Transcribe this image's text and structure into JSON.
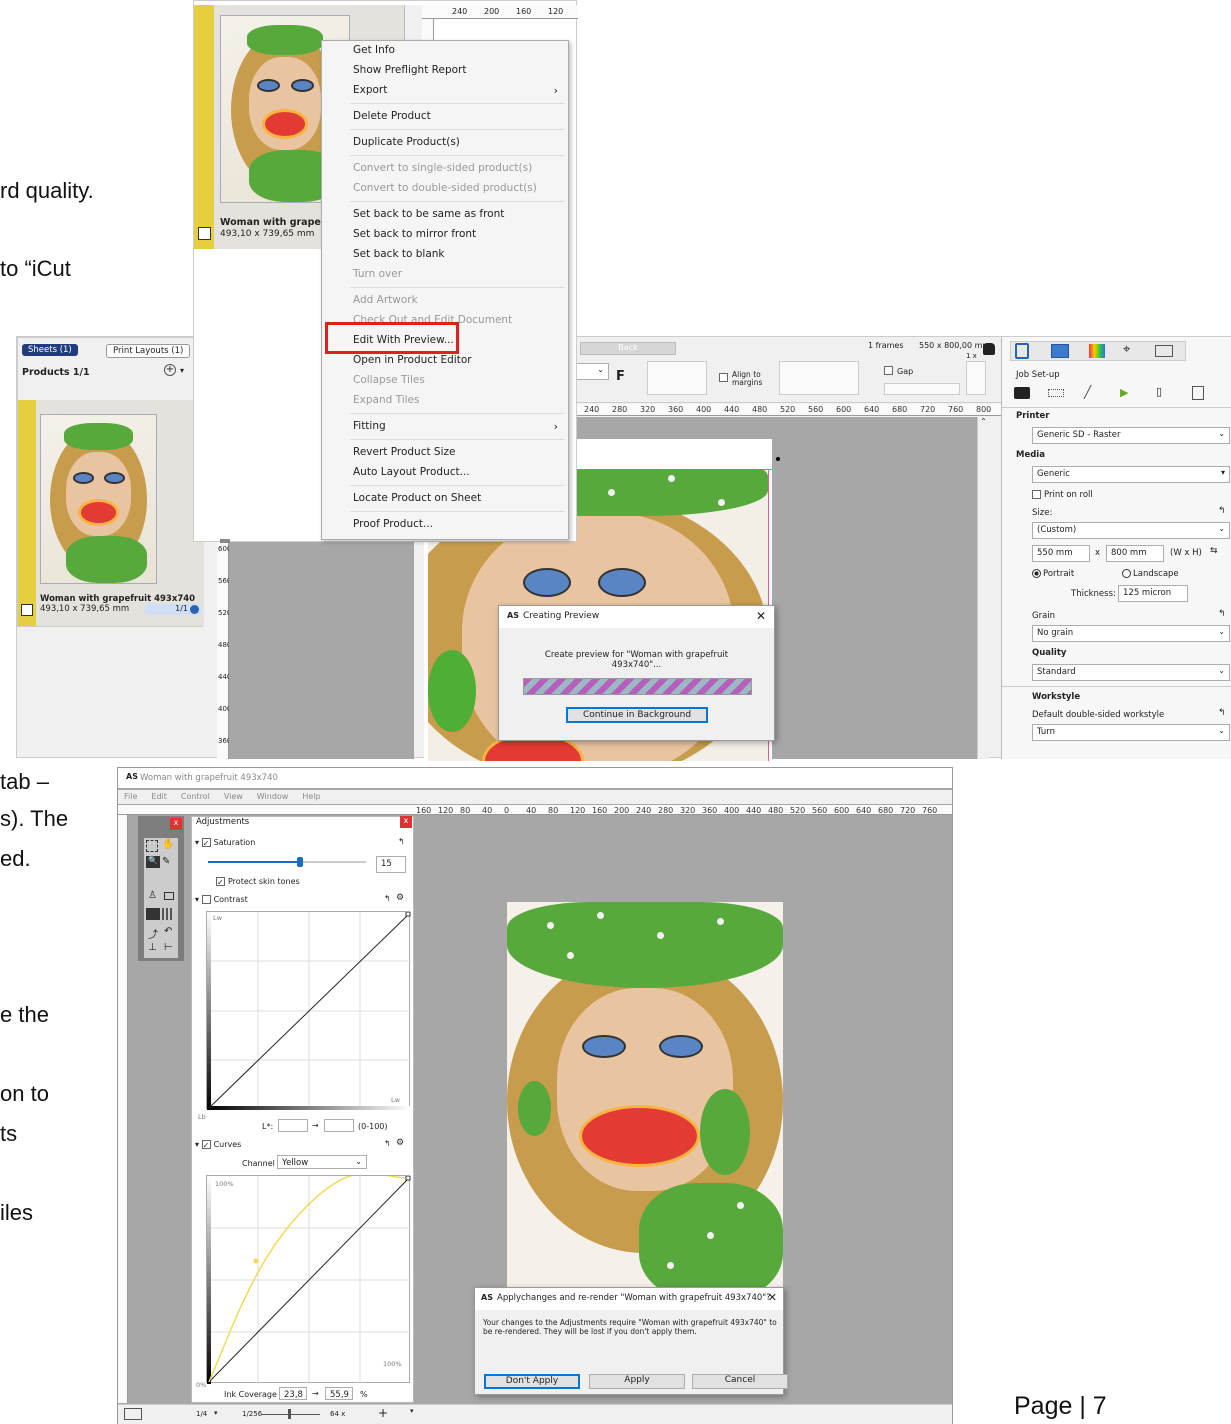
{
  "doc": {
    "fragments": [
      "rd quality.",
      "to “iCut",
      "tab –",
      "s). The",
      "ed.",
      "e the",
      "on to",
      "ts",
      "iles"
    ],
    "page_label": "Page | 7"
  },
  "top_panel": {
    "product_name": "Woman with grapefr",
    "product_size": "493,10 x 739,65 mm",
    "ruler": [
      "240",
      "200",
      "160",
      "120"
    ]
  },
  "context_menu": {
    "items": [
      {
        "label": "Get Info"
      },
      {
        "label": "Show Preflight Report"
      },
      {
        "label": "Export"
      },
      {
        "label": "Delete Product"
      },
      {
        "label": "Duplicate Product(s)"
      },
      {
        "label": "Convert to single-sided product(s)"
      },
      {
        "label": "Convert to double-sided product(s)"
      },
      {
        "label": "Set back to be same as front"
      },
      {
        "label": "Set back to mirror front"
      },
      {
        "label": "Set back to blank"
      },
      {
        "label": "Turn over"
      },
      {
        "label": "Add Artwork"
      },
      {
        "label": "Check Out and Edit Document"
      },
      {
        "label": "Edit With Preview..."
      },
      {
        "label": "Open in Product Editor"
      },
      {
        "label": "Collapse Tiles"
      },
      {
        "label": "Expand Tiles"
      },
      {
        "label": "Fitting"
      },
      {
        "label": "Revert Product Size"
      },
      {
        "label": "Auto Layout Product..."
      },
      {
        "label": "Locate Product on Sheet"
      },
      {
        "label": "Proof Product..."
      }
    ]
  },
  "left_panel": {
    "tab_sheets": "Sheets (1)",
    "tab_print_layouts": "Print Layouts (1)",
    "products_header": "Products 1/1",
    "product_name": "Woman with grapefruit 493x740",
    "product_size": "493,10 x 739,65 mm",
    "page_count": "1/1"
  },
  "mid": {
    "back_label": "Back",
    "frames": "1 frames",
    "sheet_size": "550 x 800,00 mm",
    "multiplier": "1 x",
    "align_to_margins": "Align to margins",
    "gap_label": "Gap",
    "f_label": "F",
    "ruler": [
      "240",
      "280",
      "320",
      "360",
      "400",
      "440",
      "480",
      "520",
      "560",
      "600",
      "640",
      "680",
      "720",
      "760",
      "800"
    ],
    "vruler": [
      "600",
      "560",
      "520",
      "480",
      "440",
      "400",
      "360"
    ]
  },
  "creating_preview": {
    "title": "Creating Preview",
    "message_line1": "Create preview for \"Woman with grapefruit",
    "message_line2": "493x740\"...",
    "button": "Continue in Background"
  },
  "job_setup": {
    "title": "Job Set-up",
    "printer_label": "Printer",
    "printer": "Generic SD - Raster",
    "media_label": "Media",
    "media": "Generic",
    "print_on_roll": "Print on roll",
    "size_label": "Size:",
    "size": "(Custom)",
    "width": "550 mm",
    "x": "x",
    "height": "800 mm",
    "wxh": "(W x H)",
    "portrait": "Portrait",
    "landscape": "Landscape",
    "thickness_label": "Thickness:",
    "thickness": "125 micron",
    "grain_label": "Grain",
    "grain": "No grain",
    "quality_label": "Quality",
    "quality": "Standard",
    "workstyle_label": "Workstyle",
    "workstyle_sub": "Default double-sided workstyle",
    "workstyle": "Turn"
  },
  "editor": {
    "title": "Woman with grapefruit 493x740",
    "menu": [
      "File",
      "Edit",
      "Control",
      "View",
      "Window",
      "Help"
    ],
    "ruler": [
      "160",
      "120",
      "80",
      "40",
      "0",
      "40",
      "80",
      "120",
      "160",
      "200",
      "240",
      "280",
      "320",
      "360",
      "400",
      "440",
      "480",
      "520",
      "560",
      "600",
      "640",
      "680",
      "720",
      "760"
    ],
    "adjustments_title": "Adjustments",
    "saturation_label": "Saturation",
    "saturation_value": "15",
    "saturation_level": 0.58,
    "protect_skin": "Protect skin tones",
    "contrast_label": "Contrast",
    "graph_lw": "Lw",
    "graph_lb": "Lb",
    "lstar_label": "L*:",
    "arrow": "→",
    "range_label": "(0-100)",
    "curves_label": "Curves",
    "channel_label": "Channel",
    "channel_value": "Yellow",
    "pct_100_top": "100%",
    "pct_100_bottom": "100%",
    "pct_0": "0%",
    "ink_coverage_label": "Ink Coverage",
    "ink_in": "23,8",
    "ink_out": "55,9",
    "ink_unit": "%",
    "status_zoom1": "1/4",
    "status_zoom2": "1/256",
    "status_zoom3": "64 x"
  },
  "apply_dialog": {
    "title": "Applychanges and re-render  \"Woman with grapefruit 493x740\"?",
    "message": "Your changes to the Adjustments require \"Woman with grapefruit 493x740\" to be re-rendered. They will be lost if you don't apply them.",
    "dont_apply": "Don't Apply",
    "apply": "Apply",
    "cancel": "Cancel"
  }
}
